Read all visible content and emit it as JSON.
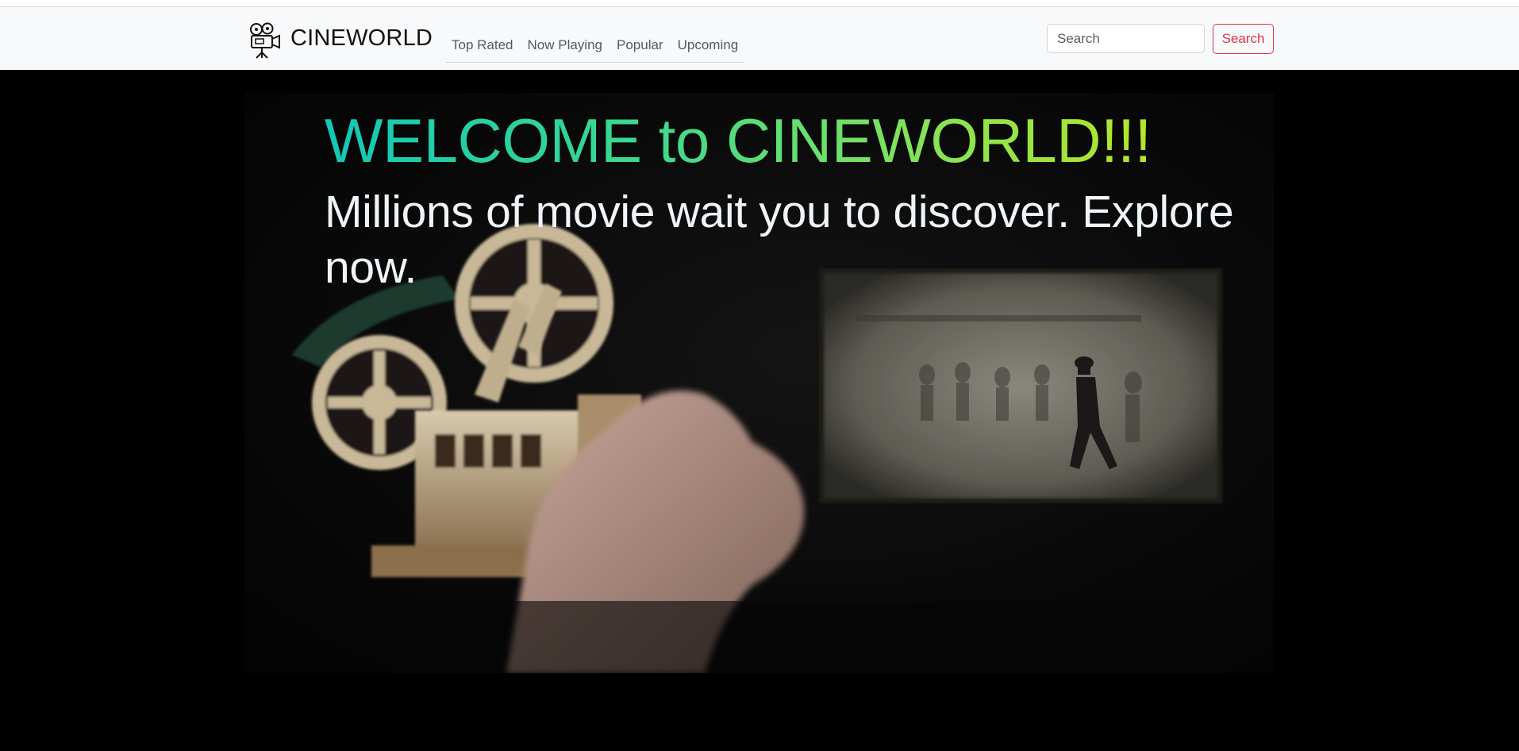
{
  "navbar": {
    "brand": "CINEWORLD",
    "brand_icon": "film-camera-icon",
    "links": [
      "Top Rated",
      "Now Playing",
      "Popular",
      "Upcoming"
    ],
    "search": {
      "placeholder": "Search",
      "value": "",
      "button_label": "Search"
    }
  },
  "hero": {
    "title": "WELCOME to CINEWORLD!!!",
    "subtitle": "Millions of movie wait you to discover. Explore now.",
    "background_image": "film-projector-and-screen-photo"
  },
  "colors": {
    "navbar_bg": "#f8f9fa",
    "page_bg": "#000000",
    "accent": "#dc3545",
    "title_gradient_start": "#12c8b6",
    "title_gradient_end": "#b7e52a",
    "subtitle": "#eef4f8"
  }
}
